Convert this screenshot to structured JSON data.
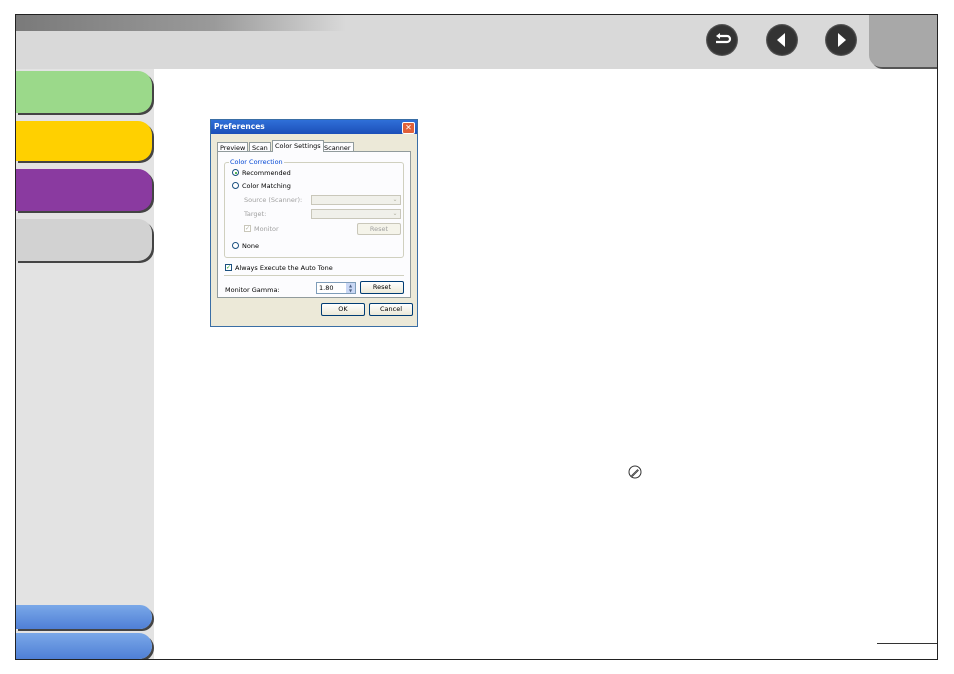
{
  "icons": {
    "back": "return-arrow-icon",
    "previous": "left-arrow-icon",
    "next": "right-arrow-icon",
    "note": "pencil-note-icon"
  },
  "colors": {
    "green_tab": "#9bd98a",
    "yellow_tab": "#ffd000",
    "purple_tab": "#8a3aa0",
    "gray_tab": "#d2d2d2",
    "blue_tab": "#5f8fdc"
  },
  "dialog": {
    "title": "Preferences",
    "close_glyph": "✕",
    "tabs": [
      "Preview",
      "Scan",
      "Color Settings",
      "Scanner"
    ],
    "active_tab": "Color Settings",
    "color_correction": {
      "group_label": "Color Correction",
      "recommended_label": "Recommended",
      "recommended_selected": true,
      "color_matching_label": "Color Matching",
      "source_label": "Source (Scanner):",
      "target_label": "Target:",
      "monitor_label": "Monitor",
      "monitor_checked": true,
      "reset_label": "Reset",
      "none_label": "None"
    },
    "auto_tone_label": "Always Execute the Auto Tone",
    "auto_tone_checked": true,
    "gamma_label": "Monitor Gamma:",
    "gamma_value": "1.80",
    "gamma_reset_label": "Reset",
    "ok_label": "OK",
    "cancel_label": "Cancel",
    "check_glyph": "✓",
    "arrow_glyph": "⌄",
    "spin_up": "▲",
    "spin_down": "▼"
  }
}
